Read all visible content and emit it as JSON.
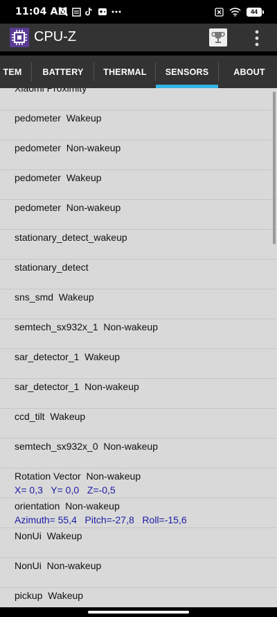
{
  "status_bar": {
    "time": "11:04 AM",
    "battery": "44",
    "left_icons": [
      "mute-icon",
      "notes-icon",
      "tiktok-icon",
      "gamepad-icon",
      "more-icon"
    ],
    "right_icons": [
      "sim-icon",
      "wifi-icon",
      "battery-icon"
    ]
  },
  "app_bar": {
    "title": "CPU-Z",
    "icons": [
      "cpu-logo-icon",
      "trophy-icon",
      "overflow-menu-icon"
    ]
  },
  "tabs": [
    {
      "label": "TEM"
    },
    {
      "label": "BATTERY"
    },
    {
      "label": "THERMAL"
    },
    {
      "label": "SENSORS",
      "active": true
    },
    {
      "label": "ABOUT"
    }
  ],
  "sensors": [
    {
      "name": "Xiaomi Proximity"
    },
    {
      "name": "pedometer  Wakeup"
    },
    {
      "name": "pedometer  Non-wakeup"
    },
    {
      "name": "pedometer  Wakeup"
    },
    {
      "name": "pedometer  Non-wakeup"
    },
    {
      "name": "stationary_detect_wakeup"
    },
    {
      "name": "stationary_detect"
    },
    {
      "name": "sns_smd  Wakeup"
    },
    {
      "name": "semtech_sx932x_1  Non-wakeup"
    },
    {
      "name": "sar_detector_1  Wakeup"
    },
    {
      "name": "sar_detector_1  Non-wakeup"
    },
    {
      "name": "ccd_tilt  Wakeup"
    },
    {
      "name": "semtech_sx932x_0  Non-wakeup"
    },
    {
      "name": "Rotation Vector  Non-wakeup",
      "values": "X= 0,3   Y= 0,0   Z=-0,5"
    },
    {
      "name": "orientation  Non-wakeup",
      "values": "Azimuth= 55,4   Pitch=-27,8   Roll=-15,6"
    },
    {
      "name": "NonUi  Wakeup"
    },
    {
      "name": "NonUi  Non-wakeup"
    },
    {
      "name": "pickup  Wakeup"
    }
  ],
  "colors": {
    "accent": "#33b5e5",
    "appbar": "#333333",
    "list_bg": "#d9d9d9",
    "value_text": "#1a1aa6"
  }
}
